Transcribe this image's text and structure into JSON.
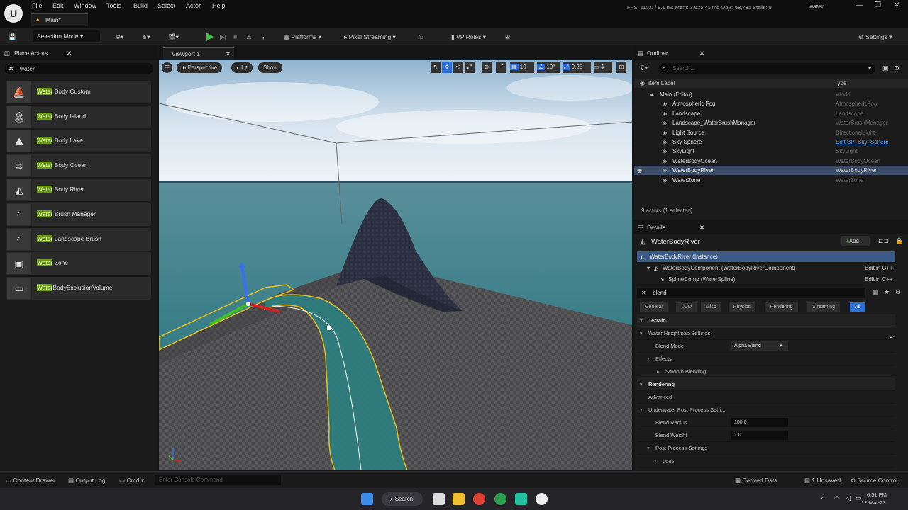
{
  "menubar": {
    "items": [
      "File",
      "Edit",
      "Window",
      "Tools",
      "Build",
      "Select",
      "Actor",
      "Help"
    ],
    "stats": "FPS: 110.0 / 9.1 ms  Mem: 3,625.41 mb  Objs: 68,731  Stalls: 0",
    "search_value": "water",
    "tab": "Main*"
  },
  "toolbar": {
    "selection_mode": "Selection Mode",
    "platforms": "Platforms",
    "pixel_streaming": "Pixel Streaming",
    "vp_roles": "VP Roles",
    "settings": "Settings"
  },
  "place_actors": {
    "title": "Place Actors",
    "search": "water",
    "items": [
      {
        "hl": "Water",
        "rest": " Body Custom",
        "icon": "⛵"
      },
      {
        "hl": "Water",
        "rest": " Body Island",
        "icon": "🏝"
      },
      {
        "hl": "Water",
        "rest": " Body Lake",
        "icon": "⛰"
      },
      {
        "hl": "Water",
        "rest": " Body Ocean",
        "icon": "≋"
      },
      {
        "hl": "Water",
        "rest": " Body River",
        "icon": "◭"
      },
      {
        "hl": "Water",
        "rest": " Brush Manager",
        "icon": "◜"
      },
      {
        "hl": "Water",
        "rest": " Landscape Brush",
        "icon": "◜"
      },
      {
        "hl": "Water",
        "rest": " Zone",
        "icon": "▣"
      },
      {
        "hl": "Water",
        "rest": "BodyExclusionVolume",
        "icon": "▭"
      }
    ]
  },
  "viewport": {
    "tab": "Viewport 1",
    "perspective": "Perspective",
    "lit": "Lit",
    "show": "Show",
    "grid": "10",
    "angle": "10°",
    "scale": "0.25",
    "cams": "4"
  },
  "outliner": {
    "title": "Outliner",
    "search_placeholder": "Search...",
    "col_label": "Item Label",
    "col_type": "Type",
    "rows": [
      {
        "name": "Main (Editor)",
        "type": "World"
      },
      {
        "name": "Atmospheric Fog",
        "type": "AtmosphericFog"
      },
      {
        "name": "Landscape",
        "type": "Landscape"
      },
      {
        "name": "Landscape_WaterBrushManager",
        "type": "WaterBrushManager"
      },
      {
        "name": "Light Source",
        "type": "DirectionalLight"
      },
      {
        "name": "Sky Sphere",
        "type": "Edit BP_Sky_Sphere"
      },
      {
        "name": "SkyLight",
        "type": "SkyLight"
      },
      {
        "name": "WaterBodyOcean",
        "type": "WaterBodyOcean"
      },
      {
        "name": "WaterBodyRiver",
        "type": "WaterBodyRiver"
      },
      {
        "name": "WaterZone",
        "type": "WaterZone"
      }
    ],
    "count": "9 actors (1 selected)"
  },
  "details": {
    "title": "Details",
    "object": "WaterBodyRiver",
    "add": "Add",
    "instance": "WaterBodyRiver (Instance)",
    "component": "WaterBodyComponent (WaterBodyRiverComponent)",
    "spline": "SplineComp (WaterSpline)",
    "edit_cpp": "Edit in C++",
    "filter": "blend",
    "tabs": [
      "General",
      "LOD",
      "Misc",
      "Physics",
      "Rendering",
      "Streaming",
      "All"
    ],
    "rows": [
      {
        "label": "Terrain",
        "value": ""
      },
      {
        "label": "Water Heightmap Settings",
        "value": ""
      },
      {
        "label": "Blend Mode",
        "value": "Alpha Blend"
      },
      {
        "label": "Effects",
        "value": ""
      },
      {
        "label": "Smooth Blending",
        "value": ""
      },
      {
        "label": "Rendering",
        "value": ""
      },
      {
        "label": "Advanced",
        "value": ""
      },
      {
        "label": "Underwater Post Process Setti...",
        "value": ""
      },
      {
        "label": "Blend Radius",
        "value": "100.0"
      },
      {
        "label": "Blend Weight",
        "value": "1.0"
      },
      {
        "label": "Post Process Settings",
        "value": ""
      },
      {
        "label": "Lens",
        "value": ""
      }
    ]
  },
  "statusbar": {
    "content_drawer": "Content Drawer",
    "output_log": "Output Log",
    "cmd": "Cmd",
    "console_placeholder": "Enter Console Command",
    "derived": "Derived Data",
    "unsaved": "1 Unsaved",
    "source": "Source Control"
  },
  "taskbar": {
    "search": "Search",
    "time": "6:51 PM",
    "date": "12-Mar-23"
  }
}
